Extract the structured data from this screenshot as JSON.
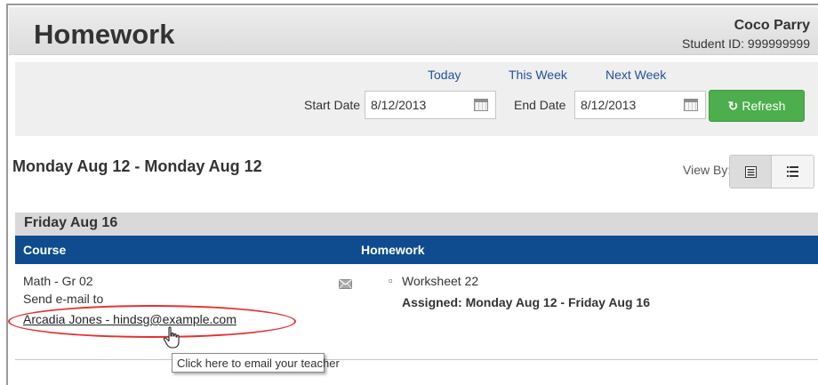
{
  "header": {
    "title": "Homework",
    "student_name": "Coco Parry",
    "student_id": "Student ID: 999999999"
  },
  "filters": {
    "quick_links": [
      "Today",
      "This Week",
      "Next Week"
    ],
    "start_label": "Start Date",
    "start_value": "8/12/2013",
    "end_label": "End Date",
    "end_value": "8/12/2013",
    "refresh_label": "Refresh"
  },
  "range_title": "Monday Aug 12 - Monday Aug 12",
  "view_by": {
    "label": "View By:",
    "options": [
      "day-view-icon",
      "list-view-icon"
    ],
    "selected": "day-view-icon"
  },
  "day": {
    "header": "Friday Aug 16",
    "columns": [
      "Course",
      "Homework"
    ],
    "row": {
      "course": "Math - Gr 02",
      "send_email_label": "Send e-mail to",
      "teacher_link": "Arcadia Jones - hindsg@example.com",
      "homework_title": "Worksheet 22",
      "assigned": "Assigned: Monday Aug 12 - Friday Aug 16"
    }
  },
  "tooltip": "Click here to email your teacher",
  "colors": {
    "table_header": "#0e4c8f",
    "refresh_button": "#4cae4c",
    "link": "#23509a",
    "highlight": "#e53030"
  }
}
